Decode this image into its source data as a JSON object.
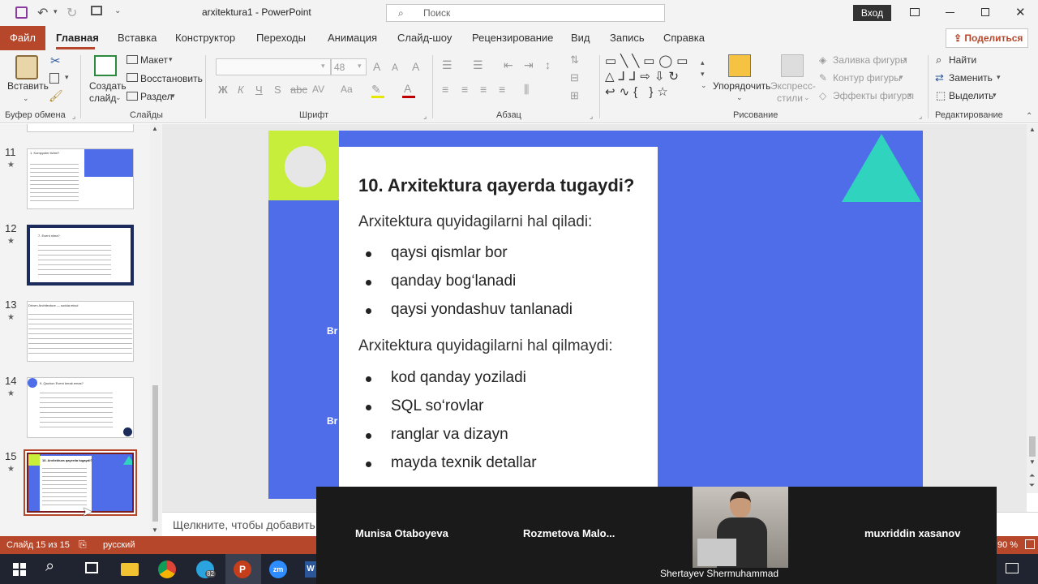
{
  "window": {
    "title": "arxitektura1 - PowerPoint",
    "search_placeholder": "Поиск",
    "login_label": "Вход"
  },
  "tabs": [
    "Файл",
    "Главная",
    "Вставка",
    "Конструктор",
    "Переходы",
    "Анимация",
    "Слайд-шоу",
    "Рецензирование",
    "Вид",
    "Запись",
    "Справка"
  ],
  "share_label": "Поделиться",
  "ribbon": {
    "paste": "Вставить",
    "new_slide_1": "Создать",
    "new_slide_2": "слайд",
    "layout": "Макет",
    "reset": "Восстановить",
    "section": "Раздел",
    "font_size": "48",
    "arrange": "Упорядочить",
    "express_1": "Экспресс-",
    "express_2": "стили",
    "fill": "Заливка фигуры",
    "outline": "Контур фигуры",
    "effects": "Эффекты фигуры",
    "find": "Найти",
    "replace": "Заменить",
    "select": "Выделить",
    "groups": {
      "clipboard": "Буфер обмена",
      "slides": "Слайды",
      "font": "Шрифт",
      "paragraph": "Абзац",
      "drawing": "Рисование",
      "editing": "Редактирование"
    }
  },
  "thumbs": [
    {
      "num": "11",
      "title": "1. Kompyuter tizimi?"
    },
    {
      "num": "12",
      "title": "7. Event nima?"
    },
    {
      "num": "13",
      "title": "Driven Architecture — sodda misol"
    },
    {
      "num": "14",
      "title": "9. Qachon Event kerak emas?"
    },
    {
      "num": "15",
      "title": "10. Arxitektura qayerda tugaydi?"
    }
  ],
  "slide": {
    "title": "10. Arxitektura qayerda tugaydi?",
    "intro1": "Arxitektura quyidagilarni hal qiladi:",
    "list1": [
      "qaysi qismlar bor",
      "qanday bog‘lanadi",
      "qaysi yondashuv tanlanadi"
    ],
    "intro2": "Arxitektura quyidagilarni hal qilmaydi:",
    "list2": [
      "kod qanday yoziladi",
      "SQL so‘rovlar",
      "ranglar va dizayn",
      "mayda texnik detallar"
    ],
    "side1": "Br",
    "side2": "Br",
    "colors": {
      "bg": "#4f6de9",
      "lime": "#c6ee3b",
      "teal": "#2fd3be"
    }
  },
  "notes_placeholder": "Щелкните, чтобы добавить з",
  "status": {
    "slide": "Слайд 15 из 15",
    "lang": "русский",
    "zoom": "90 %"
  },
  "video": {
    "p1": "Munisa Otaboyeva",
    "p2": "Rozmetova  Malo...",
    "p3": "Shertayev Shermuhammad",
    "p4": "muxriddin xasanov"
  },
  "taskbar": {
    "telegram_badge": "82"
  }
}
